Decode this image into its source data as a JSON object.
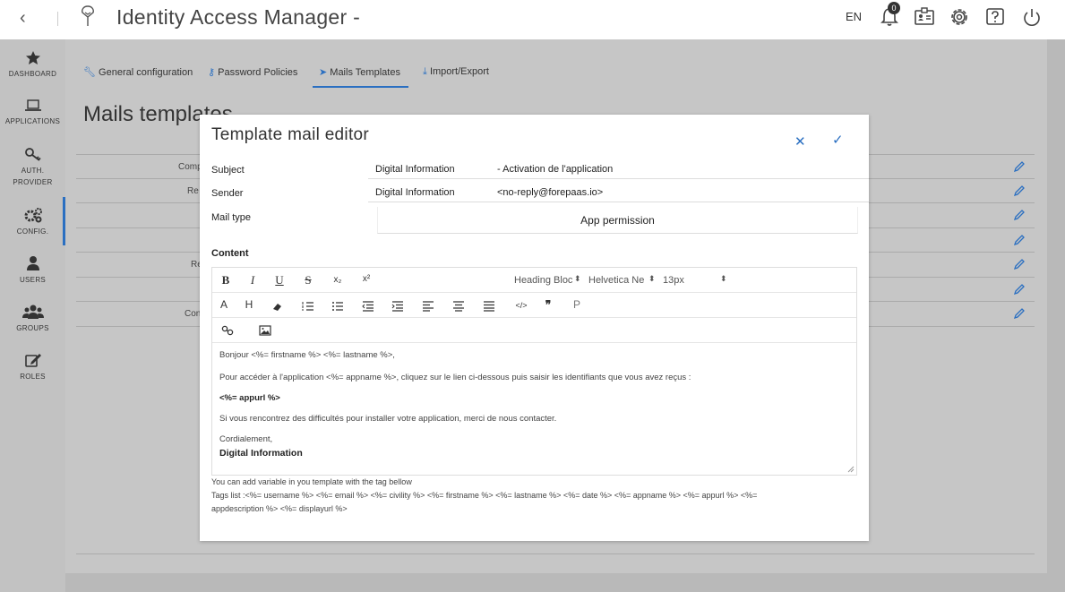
{
  "topbar": {
    "back_glyph": "‹",
    "title": "Identity Access Manager -",
    "lang": "EN",
    "notifications_count": "0",
    "icons": [
      "bell-icon",
      "id-card-icon",
      "gear-icon",
      "help-icon",
      "power-icon"
    ]
  },
  "sidebar": {
    "items": [
      {
        "label": "DASHBOARD",
        "icon": "star-icon"
      },
      {
        "label": "APPLICATIONS",
        "icon": "laptop-icon"
      },
      {
        "label": "AUTH.",
        "label2": "PROVIDER",
        "icon": "key-icon"
      },
      {
        "label": "CONFIG.",
        "icon": "gears-icon"
      },
      {
        "label": "USERS",
        "icon": "user-icon"
      },
      {
        "label": "GROUPS",
        "icon": "group-icon"
      },
      {
        "label": "ROLES",
        "icon": "edit-icon"
      }
    ],
    "active": "CONFIG."
  },
  "main": {
    "tabs": [
      {
        "label": "General configuration",
        "icon": "wrench-icon"
      },
      {
        "label": "Password Policies",
        "icon": "key-icon"
      },
      {
        "label": "Mails Templates",
        "icon": "send-icon"
      },
      {
        "label": "Import/Export",
        "icon": "download-icon"
      }
    ],
    "active_tab": "Mails Templates",
    "page_title": "Mails templates",
    "row_labels": [
      "Comp",
      "Re",
      "Re",
      "Con"
    ]
  },
  "modal": {
    "title": "Template mail editor",
    "close_glyph": "✕",
    "confirm_glyph": "✓",
    "subject_label": "Subject",
    "subject_part1": "Digital Information",
    "subject_part2": "- Activation de l'application",
    "sender_label": "Sender",
    "sender_part1": "Digital Information",
    "sender_part2": "<no-reply@forepaas.io>",
    "mailtype_label": "Mail type",
    "mailtype_value": "App permission",
    "content_label": "Content",
    "toolbar": {
      "bold": "B",
      "italic": "I",
      "underline": "U",
      "strike": "S",
      "subscript": "x₂",
      "superscript": "x²",
      "heading_select": "Heading Bloc",
      "font_select": "Helvetica Ne",
      "size_select": "13px",
      "font_color": "A",
      "highlight": "H",
      "code": "</>",
      "quote": "❞",
      "paragraph": "P"
    },
    "body_lines": [
      "Bonjour <%= firstname %> <%= lastname %>,",
      "Pour accéder à l'application <%= appname %>, cliquez sur le lien ci-dessous puis saisir les identifiants que vous avez reçus :",
      "<%= appurl %>",
      "Si vous rencontrez des difficultés pour installer votre application, merci de nous contacter.",
      "Cordialement,",
      "Digital Information"
    ],
    "hint_line1": "You can add variable in you template with the tag bellow",
    "hint_line2": "Tags list :<%= username %> <%= email %> <%= civility %> <%= firstname %> <%= lastname %> <%= date %> <%= appname %> <%= appurl %> <%=",
    "hint_line3": "appdescription %> <%= displayurl %>"
  },
  "colors": {
    "accent": "#2a6fc1",
    "overlay_bg": "#b9b9b9",
    "sidebar_bg": "#c2c2c2"
  }
}
